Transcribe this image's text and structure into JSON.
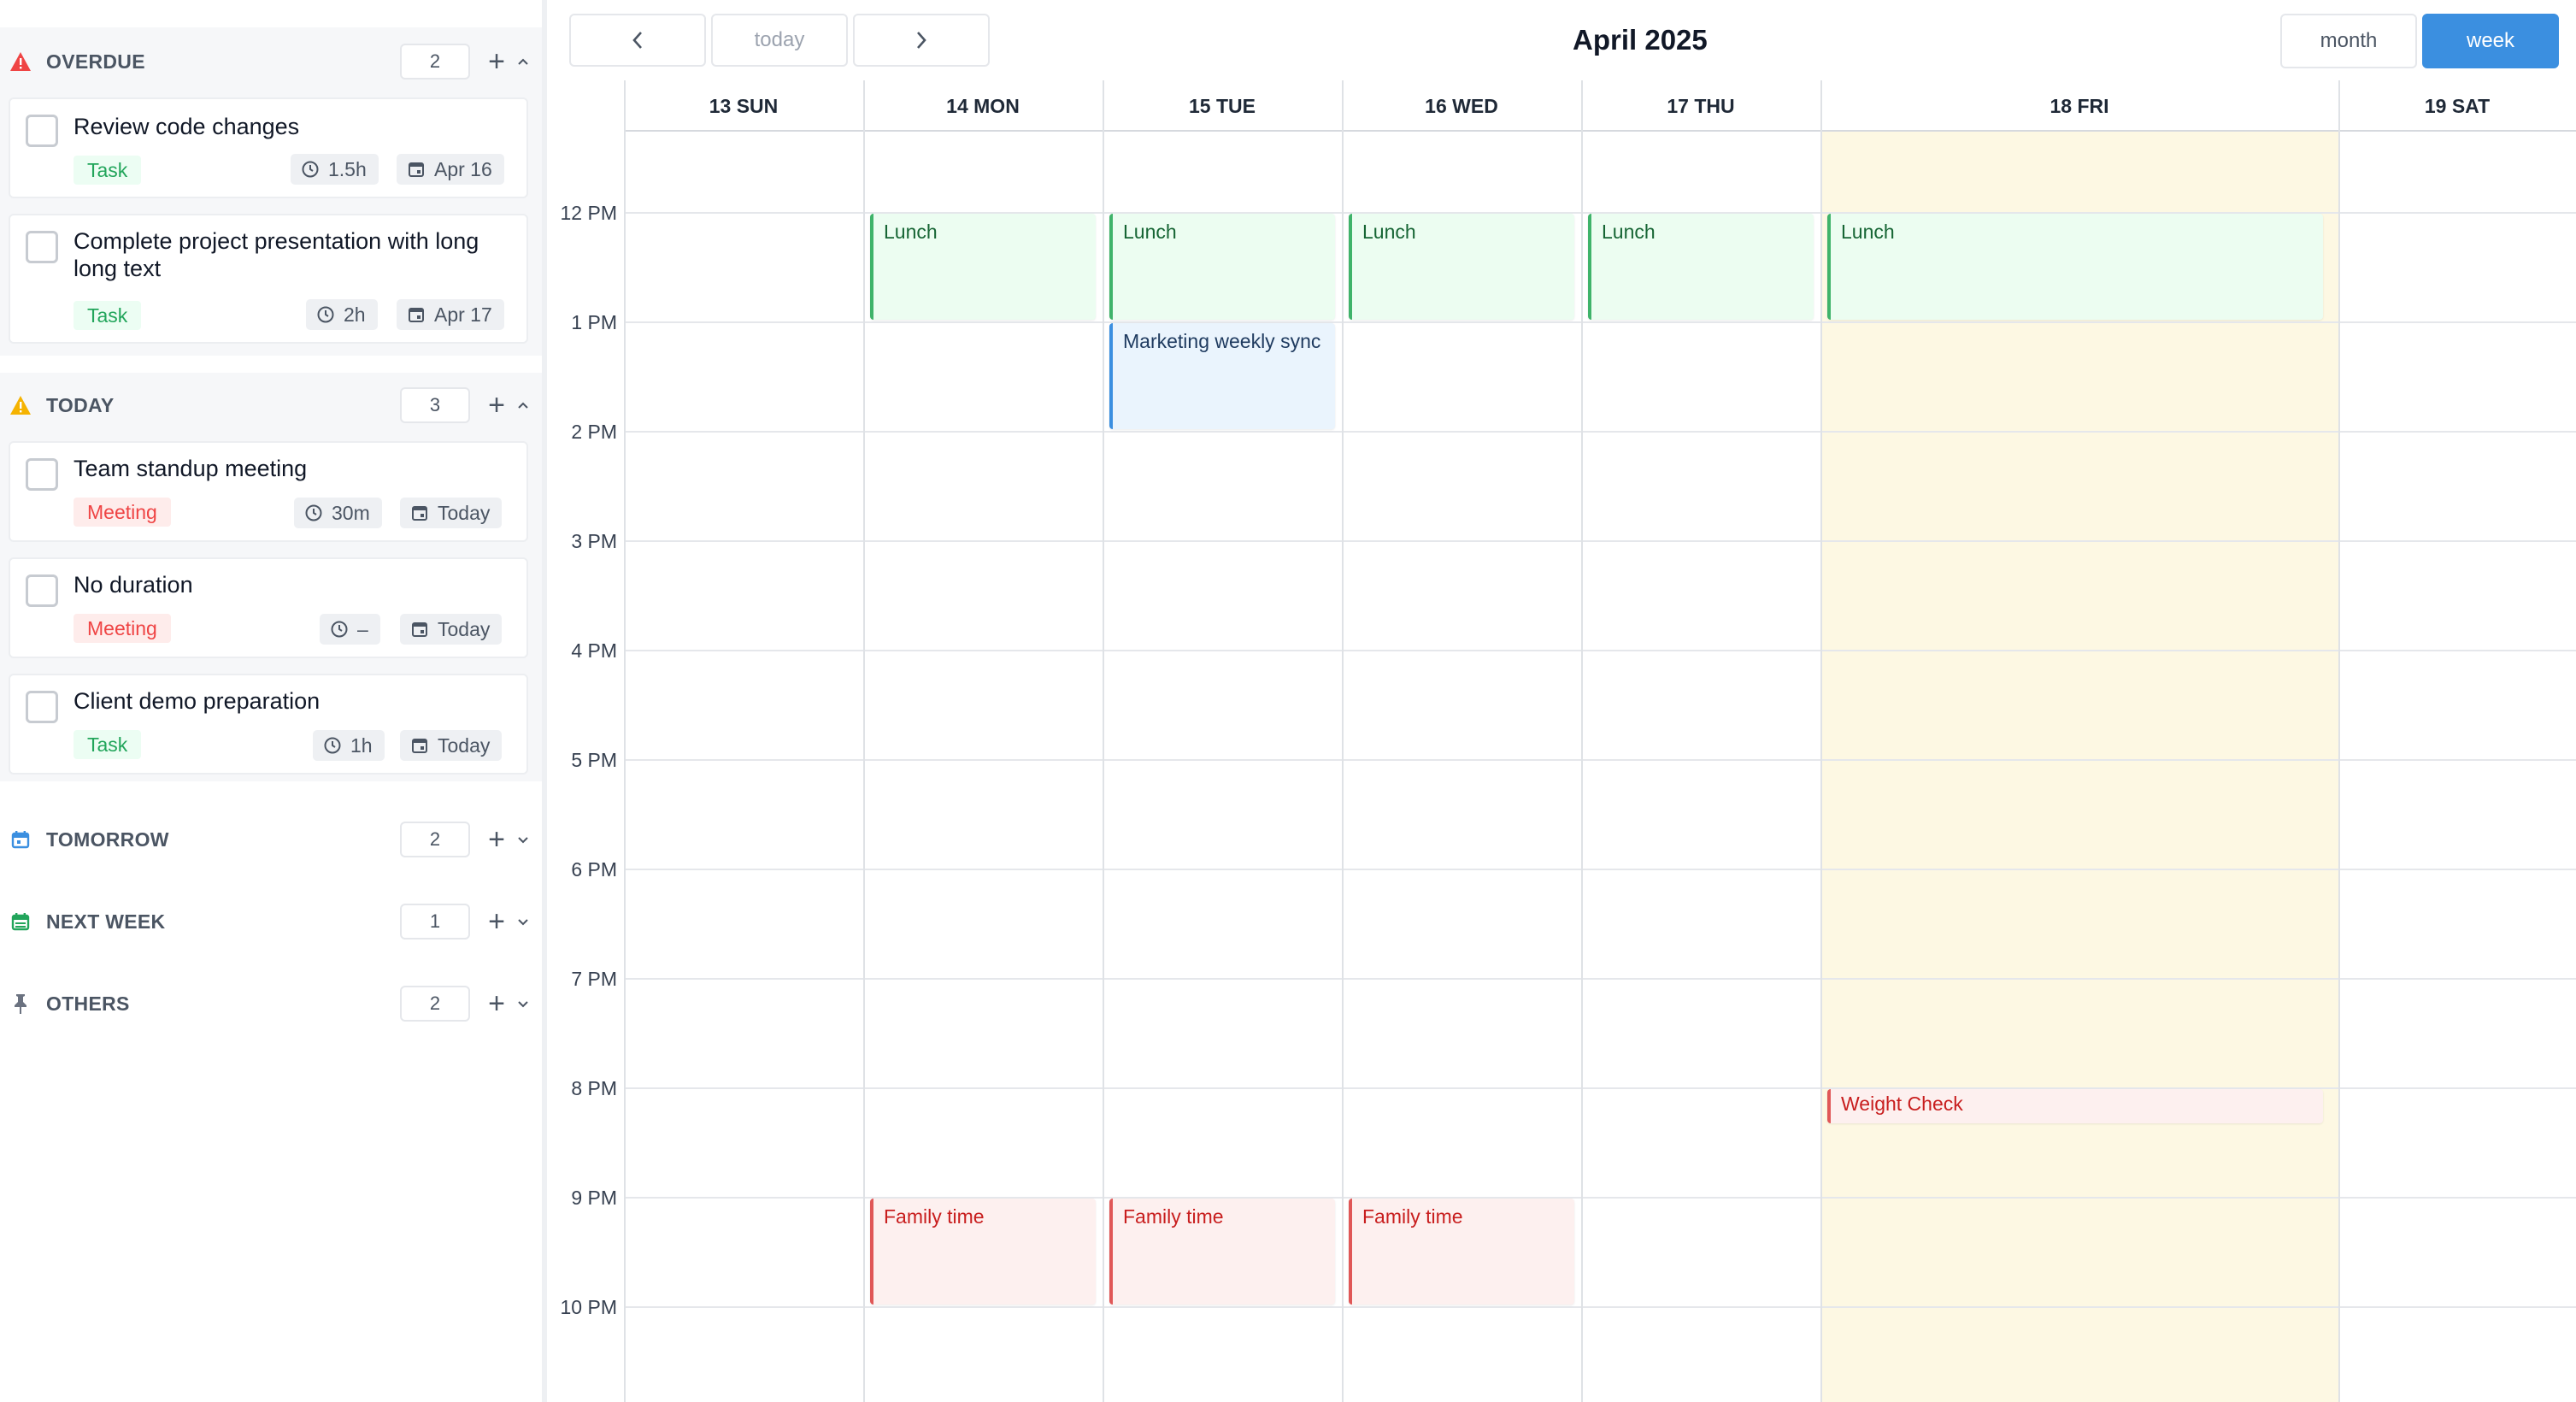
{
  "sidebar": {
    "overdue": {
      "title": "OVERDUE",
      "count": "2",
      "tasks": [
        {
          "title": "Review code changes",
          "tag": "Task",
          "duration": "1.5h",
          "date": "Apr 16"
        },
        {
          "title": "Complete project presentation with long long text",
          "tag": "Task",
          "duration": "2h",
          "date": "Apr 17"
        }
      ]
    },
    "today": {
      "title": "TODAY",
      "count": "3",
      "tasks": [
        {
          "title": "Team standup meeting",
          "tag": "Meeting",
          "duration": "30m",
          "date": "Today"
        },
        {
          "title": "No duration",
          "tag": "Meeting",
          "duration": "–",
          "date": "Today"
        },
        {
          "title": "Client demo preparation",
          "tag": "Task",
          "duration": "1h",
          "date": "Today"
        }
      ]
    },
    "tomorrow": {
      "title": "TOMORROW",
      "count": "2"
    },
    "next_week": {
      "title": "NEXT WEEK",
      "count": "1"
    },
    "others": {
      "title": "OTHERS",
      "count": "2"
    }
  },
  "calendar": {
    "title": "April 2025",
    "today_label": "today",
    "month_label": "month",
    "week_label": "week",
    "days": [
      "13 SUN",
      "14 MON",
      "15 TUE",
      "16 WED",
      "17 THU",
      "18 FRI",
      "19 SAT"
    ],
    "hours": [
      "12 PM",
      "1 PM",
      "2 PM",
      "3 PM",
      "4 PM",
      "5 PM",
      "6 PM",
      "7 PM",
      "8 PM",
      "9 PM",
      "10 PM"
    ],
    "events": {
      "lunch": "Lunch",
      "marketing": "Marketing weekly sync",
      "weight": "Weight Check",
      "family": "Family time"
    }
  },
  "colors": {
    "accent": "#3b8fe0",
    "today_column": "#fdf8e3",
    "overdue_icon": "#ef4444",
    "today_icon": "#f5b301"
  }
}
